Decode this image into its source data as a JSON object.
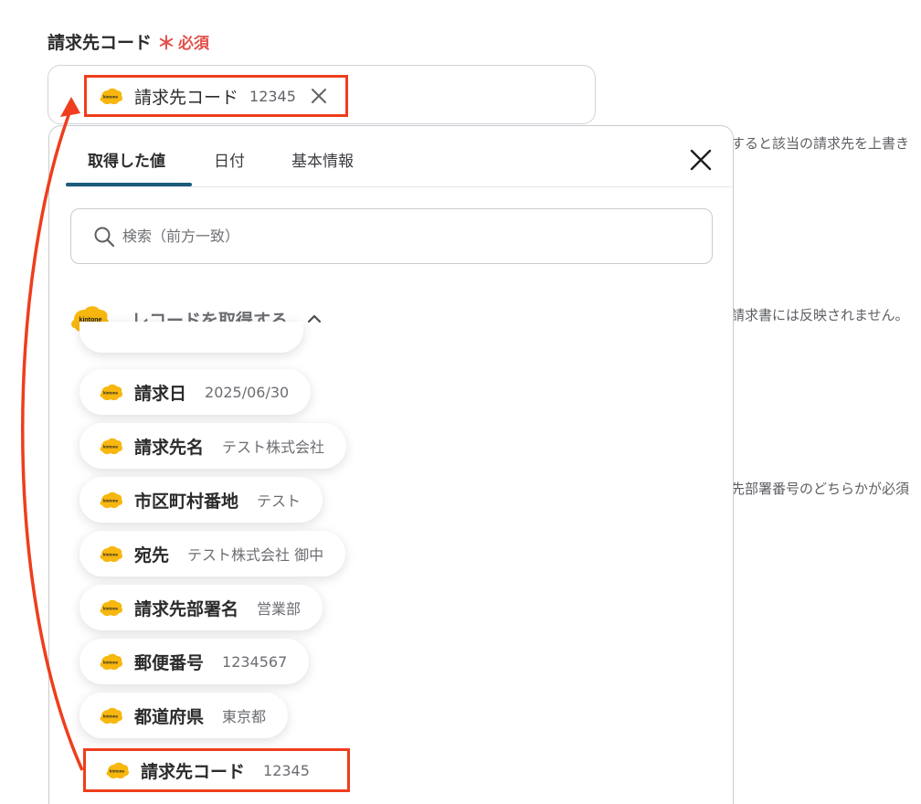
{
  "field": {
    "label": "請求先コード",
    "required_star": "＊",
    "required_text": "必須"
  },
  "selected_chip": {
    "label": "請求先コード",
    "value": "12345",
    "logo_text": "kintone"
  },
  "background_hints": [
    "すると該当の請求先を上書き",
    "請求書には反映されません。",
    "先部署番号のどちらかが必須"
  ],
  "panel": {
    "tabs": [
      {
        "label": "取得した値"
      },
      {
        "label": "日付"
      },
      {
        "label": "基本情報"
      }
    ],
    "search_placeholder": "検索（前方一致）",
    "section": {
      "title": "レコードを取得する",
      "logo_text": "kintone"
    },
    "items": [
      {
        "label": "請求日",
        "value": "2025/06/30"
      },
      {
        "label": "請求先名",
        "value": "テスト株式会社"
      },
      {
        "label": "市区町村番地",
        "value": "テスト"
      },
      {
        "label": "宛先",
        "value": "テスト株式会社 御中"
      },
      {
        "label": "請求先部署名",
        "value": "営業部"
      },
      {
        "label": "郵便番号",
        "value": "1234567"
      },
      {
        "label": "都道府県",
        "value": "東京都"
      },
      {
        "label": "請求先コード",
        "value": "12345"
      }
    ]
  },
  "colors": {
    "highlight": "#ee3e1d",
    "required": "#e2504a",
    "tab_active": "#1a5a7a",
    "kintone_yellow": "#f7b70f"
  }
}
